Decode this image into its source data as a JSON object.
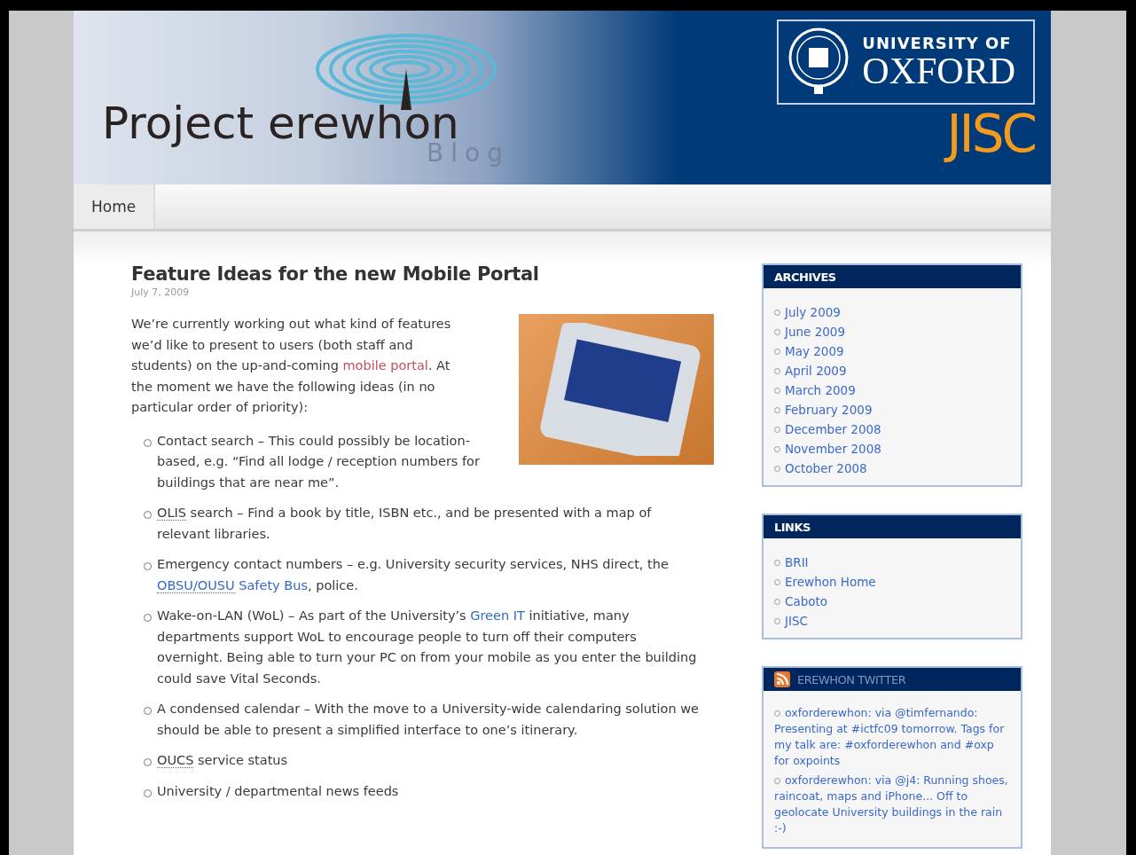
{
  "header": {
    "title": "Project erewhon",
    "subtitle": "Blog",
    "university_of": "UNIVERSITY OF",
    "oxford": "OXFORD",
    "jisc": "JISC"
  },
  "nav": [
    {
      "label": "Home",
      "selected": true
    }
  ],
  "post": {
    "title": "Feature Ideas for the new Mobile Portal",
    "date": "July 7, 2009",
    "intro": [
      {
        "text": "We’re currently working out what kind of features we’d like to present to users (both staff and students) on the up-and-coming "
      },
      {
        "text": "mobile portal",
        "kind": "link"
      },
      {
        "text": ". At the moment we have the following ideas (in no particular order of priority):"
      }
    ],
    "items": [
      [
        {
          "text": "Contact search – This could possibly be location-based, e.g. “Find all lodge / reception numbers for buildings that are near me”."
        }
      ],
      [
        {
          "text": "OLIS",
          "kind": "abbr"
        },
        {
          "text": " search – Find a book by title, ISBN etc., and be presented with a map of relevant libraries."
        }
      ],
      [
        {
          "text": "Emergency contact numbers – e.g. University security services, NHS direct, the "
        },
        {
          "text": "OBSU/OUSU",
          "kind": "abbr-link"
        },
        {
          "text": " Safety Bus",
          "kind": "link"
        },
        {
          "text": ", police."
        }
      ],
      [
        {
          "text": "Wake-on-LAN (WoL) – As part of the University’s "
        },
        {
          "text": "Green IT",
          "kind": "link"
        },
        {
          "text": " initiative, many departments support WoL to encourage people to turn off their computers overnight. Being able to turn your PC on from your mobile as you enter the building could save Vital Seconds."
        }
      ],
      [
        {
          "text": "A condensed calendar – With the move to a University-wide calendaring solution we should be able to present a simplified interface to one’s itinerary."
        }
      ],
      [
        {
          "text": "OUCS",
          "kind": "abbr"
        },
        {
          "text": " service status"
        }
      ],
      [
        {
          "text": "University / departmental news feeds"
        }
      ]
    ]
  },
  "sidebar": [
    {
      "title": "ARCHIVES",
      "kind": "list",
      "items": [
        "July 2009",
        "June 2009",
        "May 2009",
        "April 2009",
        "March 2009",
        "February 2009",
        "December 2008",
        "November 2008",
        "October 2008"
      ]
    },
    {
      "title": "LINKS",
      "kind": "list",
      "items": [
        "BRII",
        "Erewhon Home",
        "Caboto",
        "JISC"
      ]
    },
    {
      "title": "EREWHON TWITTER",
      "kind": "feed",
      "items": [
        "oxforderewhon: via @timfernando: Presenting at #ictfc09 tomorrow. Tags for my talk are: #oxforderewhon and #oxp for oxpoints",
        "oxforderewhon: via @j4: Running shoes, raincoat, maps and iPhone... Off to geolocate University buildings in the rain :-)"
      ]
    }
  ]
}
